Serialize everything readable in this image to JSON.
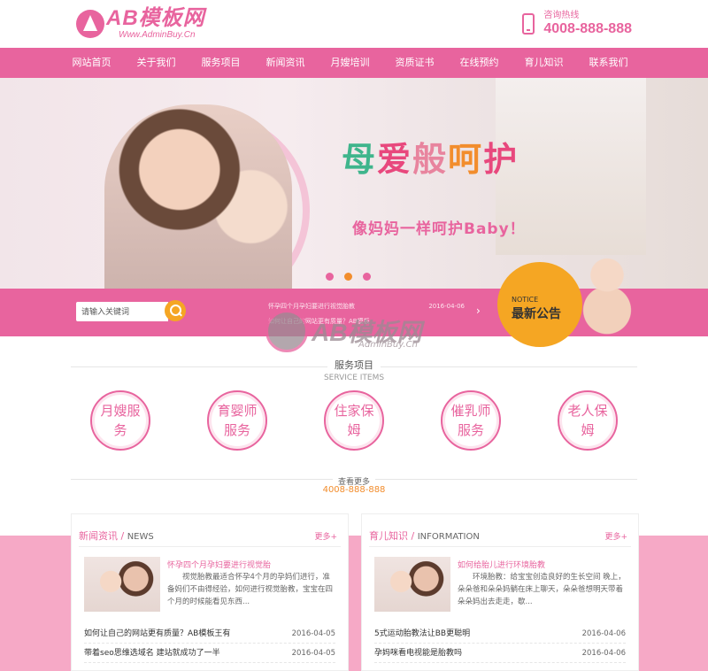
{
  "header": {
    "logo_title": "AB模板网",
    "logo_url": "Www.AdminBuy.Cn",
    "hotline_label": "咨询热线",
    "hotline_number": "4008-888-888"
  },
  "nav": {
    "items": [
      "网站首页",
      "关于我们",
      "服务项目",
      "新闻资讯",
      "月嫂培训",
      "资质证书",
      "在线预约",
      "育儿知识",
      "联系我们"
    ]
  },
  "banner": {
    "slogan_chars": [
      "母",
      "爱",
      "般",
      "呵",
      "护"
    ],
    "slogan_sub": "像妈妈一样呵护Baby！"
  },
  "search": {
    "placeholder": "请输入关键词"
  },
  "notice": {
    "rows": [
      {
        "title": "怀孕四个月孕妇要进行视觉胎教",
        "date": "2016-04-06"
      },
      {
        "title": "如何让自己的网站更有质量？AB模板",
        "date": ""
      }
    ],
    "label_en": "NOTICE",
    "label_cn": "最新公告"
  },
  "watermark": {
    "title": "AB模板网",
    "sub": "AdminBuy.Cn"
  },
  "services_section": {
    "title": "服务项目",
    "title_en": "SERVICE ITEMS",
    "items": [
      "月嫂服务",
      "育婴师服务",
      "住家保姆",
      "催乳师服务",
      "老人保姆"
    ],
    "more_label": "查看更多",
    "phone": "4008-888-888"
  },
  "news_panel": {
    "title": "新闻资讯",
    "title_en": "NEWS",
    "more": "更多+",
    "feature_title": "怀孕四个月孕妇要进行视觉胎",
    "feature_text": "视觉胎教最适合怀孕4个月的孕妈们进行，准备妈们不由得经验，如何进行视觉胎教，宝宝在四个月的时候能看见东西...",
    "items": [
      {
        "title": "如何让自己的网站更有质量？AB模板王有",
        "date": "2016-04-05"
      },
      {
        "title": "带着seo思维选域名 建站就成功了一半",
        "date": "2016-04-05"
      }
    ]
  },
  "knowledge_panel": {
    "title": "育儿知识",
    "title_en": "INFORMATION",
    "more": "更多+",
    "feature_title": "如何给胎儿进行环境胎教",
    "feature_text": "环境胎教：给宝宝创造良好的生长空间 晚上，朵朵爸和朵朵妈躺在床上聊天，朵朵爸想明天带着朵朵妈出去走走，歇...",
    "items": [
      {
        "title": "5式运动胎教法让BB更聪明",
        "date": "2016-04-06"
      },
      {
        "title": "孕妈咪看电视能是胎教吗",
        "date": "2016-04-06"
      }
    ]
  }
}
